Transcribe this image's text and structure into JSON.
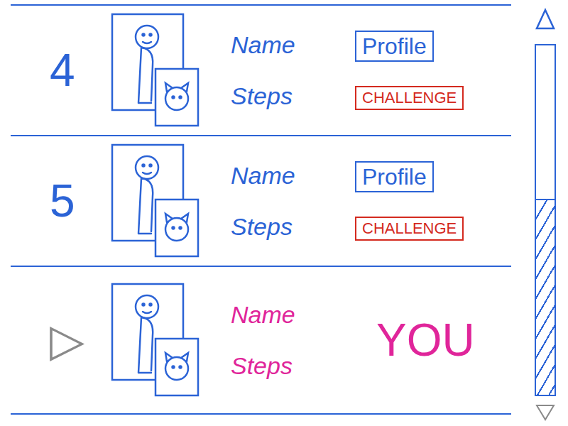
{
  "leaderboard": {
    "rows": [
      {
        "kind": "other",
        "rank": "4",
        "name": "Name",
        "steps": "Steps",
        "buttons": [
          {
            "label": "Profile",
            "color": "#2b63d6"
          },
          {
            "label": "CHALLENGE",
            "color": "#d42a1f"
          }
        ]
      },
      {
        "kind": "other",
        "rank": "5",
        "name": "Name",
        "steps": "Steps",
        "buttons": [
          {
            "label": "Profile",
            "color": "#2b63d6"
          },
          {
            "label": "CHALLENGE",
            "color": "#d42a1f"
          }
        ]
      },
      {
        "kind": "you",
        "rank": "▷",
        "name": "Name",
        "steps": "Steps",
        "badge": "YOU"
      }
    ]
  },
  "scrollbar": {
    "level": 0.56
  }
}
